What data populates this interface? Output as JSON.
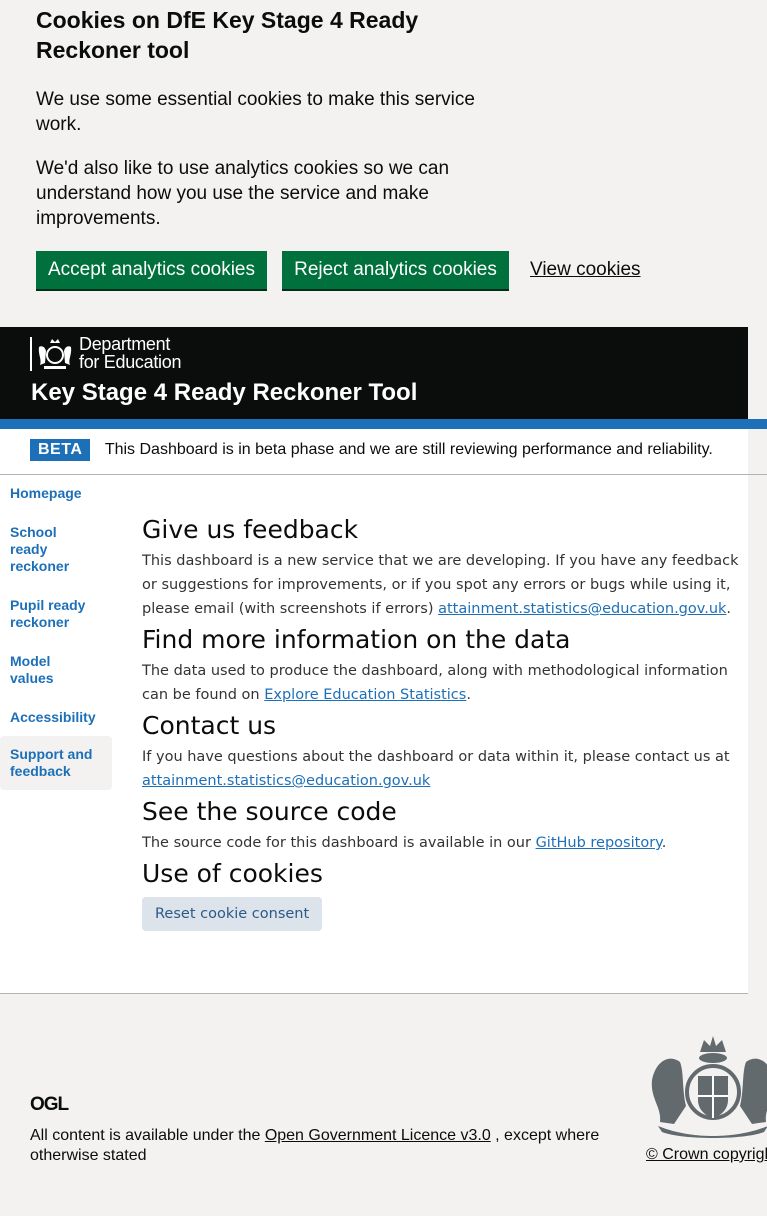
{
  "cookie_banner": {
    "title": "Cookies on DfE Key Stage 4 Ready Reckoner tool",
    "p1": "We use some essential cookies to make this service work.",
    "p2": "We'd also like to use analytics cookies so we can understand how you use the service and make improvements.",
    "accept_label": "Accept analytics cookies",
    "reject_label": "Reject analytics cookies",
    "view_label": "View cookies"
  },
  "header": {
    "dept_line1": "Department",
    "dept_line2": "for Education",
    "app_title": "Key Stage 4 Ready Reckoner Tool"
  },
  "beta": {
    "tag": "BETA",
    "text": "This Dashboard is in beta phase and we are still reviewing performance and reliability."
  },
  "nav": {
    "items": [
      {
        "line1": "Homepage",
        "line2": "",
        "line3": ""
      },
      {
        "line1": "School",
        "line2": "ready",
        "line3": "reckoner"
      },
      {
        "line1": "Pupil ready",
        "line2": "reckoner",
        "line3": ""
      },
      {
        "line1": "Model",
        "line2": "values",
        "line3": ""
      },
      {
        "line1": "Accessibility",
        "line2": "",
        "line3": ""
      },
      {
        "line1": "Support and",
        "line2": "feedback",
        "line3": ""
      }
    ]
  },
  "content": {
    "feedback_heading": "Give us feedback",
    "feedback_text": "This dashboard is a new service that we are developing. If you have any feedback or suggestions for improvements, or if you spot any errors or bugs while using it, please email (with screenshots if errors) ",
    "email": "attainment.statistics@education.gov.uk",
    "info_heading": "Find more information on the data",
    "info_text": "The data used to produce the dashboard, along with methodological information can be found on ",
    "ees_link": "Explore Education Statistics",
    "contact_heading": "Contact us",
    "contact_text": "If you have questions about the dashboard or data within it, please contact us at",
    "source_heading": "See the source code",
    "source_text": "The source code for this dashboard is available in our ",
    "github_link": "GitHub repository",
    "cookies_heading": "Use of cookies",
    "reset_label": "Reset cookie consent",
    "period": "."
  },
  "footer": {
    "ogl": "OGL",
    "licence_pre": "All content is available under the ",
    "licence_link": "Open Government Licence v3.0",
    "licence_post": " , except where otherwise stated",
    "crown": "© Crown copyright"
  }
}
